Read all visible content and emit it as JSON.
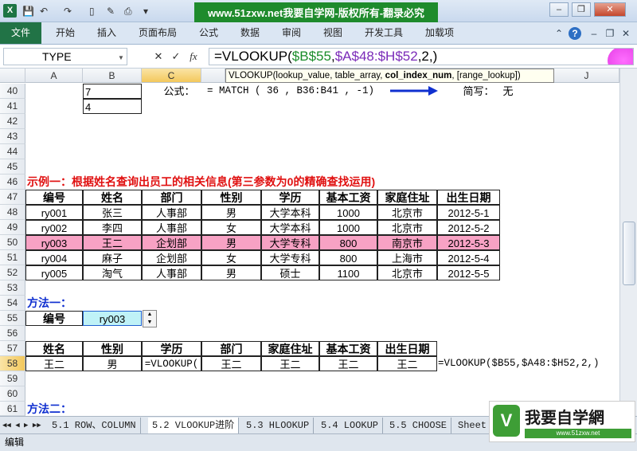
{
  "titlebar": {
    "app_icon": "X",
    "banner": "www.51zxw.net我要自学网-版权所有-翻录必究",
    "win_minimize": "–",
    "win_restore": "❐",
    "win_close": "✕"
  },
  "ribbon": {
    "file": "文件",
    "tabs": [
      "开始",
      "插入",
      "页面布局",
      "公式",
      "数据",
      "审阅",
      "视图",
      "开发工具",
      "加载项"
    ]
  },
  "formula_bar": {
    "name_box": "TYPE",
    "cancel": "✕",
    "enter": "✓",
    "fx": "fx",
    "formula_prefix": "=VLOOKUP(",
    "formula_arg1": "$B$55",
    "formula_sep1": ",",
    "formula_arg2": "$A$48:$H$52",
    "formula_sep2": ",2,)"
  },
  "tooltip": {
    "text_a": "VLOOKUP(lookup_value, table_array, ",
    "text_b": "col_index_num",
    "text_c": ", [range_lookup])"
  },
  "columns": [
    "A",
    "B",
    "C",
    "J"
  ],
  "rows": [
    "40",
    "41",
    "42",
    "43",
    "44",
    "45",
    "46",
    "47",
    "48",
    "49",
    "50",
    "51",
    "52",
    "53",
    "54",
    "55",
    "56",
    "57",
    "58",
    "59",
    "60",
    "61"
  ],
  "r40": {
    "b": "7",
    "formula_label": "公式：",
    "formula": "= MATCH ( 36 , B36:B41 , -1)",
    "short_label": "简写：",
    "short_value": "无"
  },
  "r41": {
    "b": "4"
  },
  "example_title": "示例一：根据姓名查询出员工的相关信息(第三参数为0的精确查找运用)",
  "table": {
    "headers": [
      "编号",
      "姓名",
      "部门",
      "性别",
      "学历",
      "基本工资",
      "家庭住址",
      "出生日期"
    ],
    "rows": [
      [
        "ry001",
        "张三",
        "人事部",
        "男",
        "大学本科",
        "1000",
        "北京市",
        "2012-5-1"
      ],
      [
        "ry002",
        "李四",
        "人事部",
        "女",
        "大学本科",
        "1000",
        "北京市",
        "2012-5-2"
      ],
      [
        "ry003",
        "王二",
        "企划部",
        "男",
        "大学专科",
        "800",
        "南京市",
        "2012-5-3"
      ],
      [
        "ry004",
        "麻子",
        "企划部",
        "女",
        "大学专科",
        "800",
        "上海市",
        "2012-5-4"
      ],
      [
        "ry005",
        "淘气",
        "人事部",
        "男",
        "硕士",
        "1100",
        "北京市",
        "2012-5-5"
      ]
    ]
  },
  "method1": {
    "title": "方法一：",
    "id_label": "编号",
    "id_value": "ry003",
    "headers": [
      "姓名",
      "性别",
      "学历",
      "部门",
      "家庭住址",
      "基本工资",
      "出生日期"
    ],
    "values": [
      "王二",
      "男",
      "=VLOOKUP(",
      "王二",
      "王二",
      "王二",
      "王二"
    ],
    "formula_note": "=VLOOKUP($B55,$A48:$H52,2,)"
  },
  "method2": {
    "title": "方法二："
  },
  "sheets": [
    "5.1 ROW、COLUMN",
    "5.2 VLOOKUP进阶",
    "5.3 HLOOKUP",
    "5.4 LOOKUP",
    "5.5 CHOOSE",
    "Sheet"
  ],
  "status": {
    "mode": "编辑"
  },
  "watermark": {
    "logo": "V",
    "text": "我要自学網",
    "url": "www.51zxw.net"
  }
}
